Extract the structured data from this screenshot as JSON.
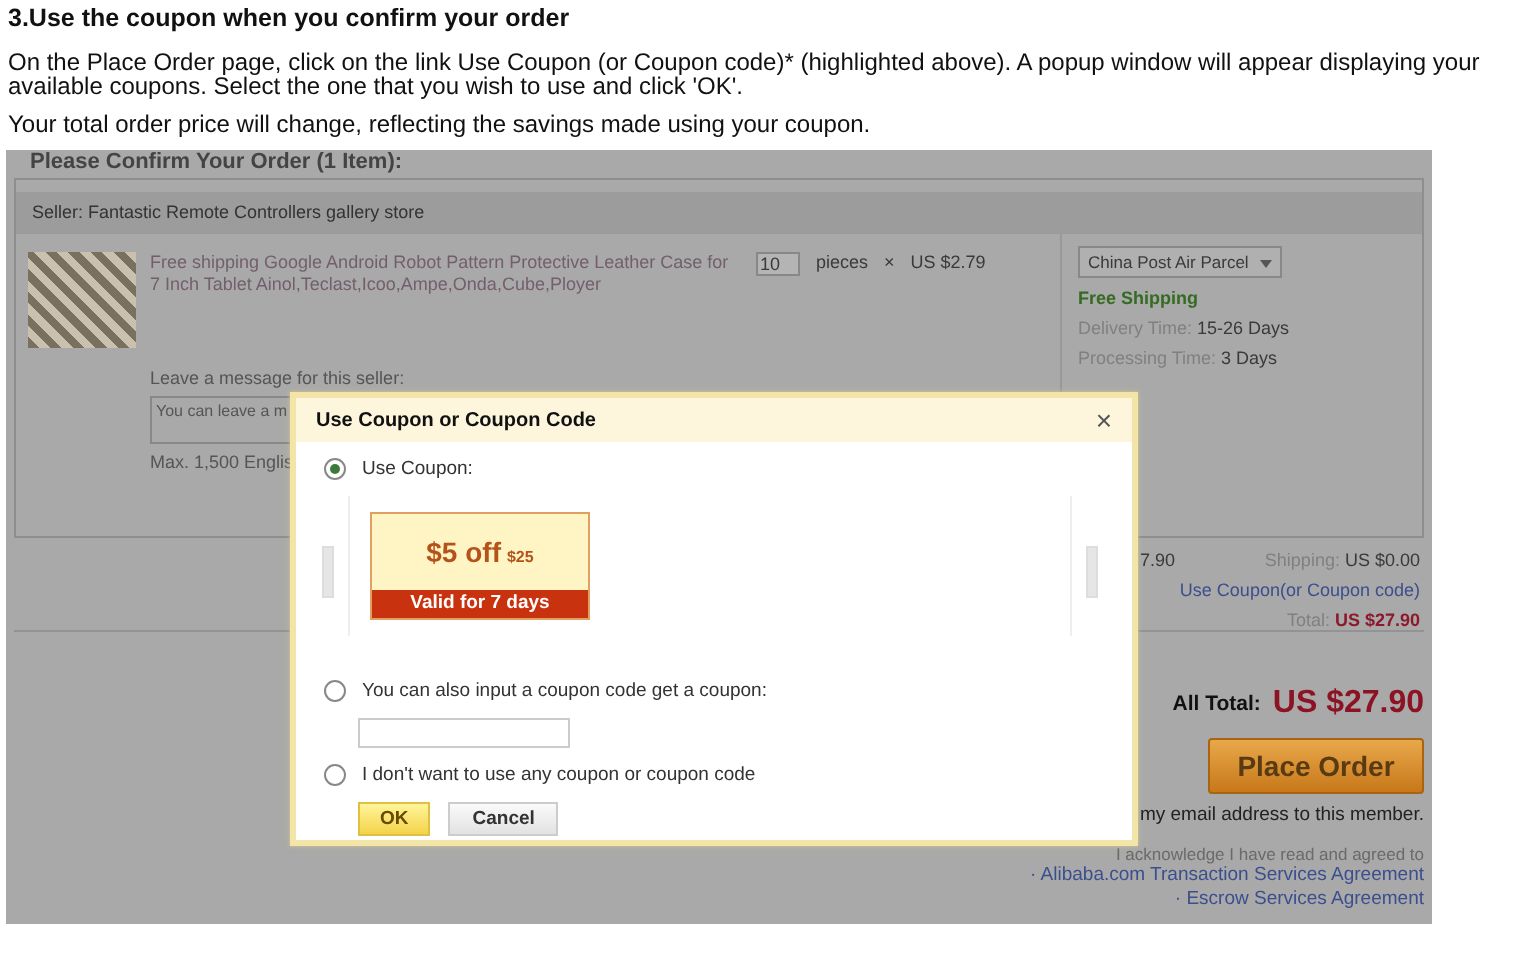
{
  "article": {
    "heading": "3.Use the coupon when you confirm your order",
    "paragraphs": [
      "On the Place Order page, click on the link Use Coupon (or Coupon code)* (highlighted above). A popup window will appear displaying your available coupons. Select the one that you wish to use and click 'OK'.",
      "Your total order price will change, reflecting the savings made using your coupon."
    ]
  },
  "order": {
    "heading": "Please Confirm Your Order (1 Item):",
    "seller": "Seller: Fantastic Remote Controllers gallery store",
    "product": {
      "title": "Free shipping Google Android Robot Pattern Protective Leather Case for 7 Inch Tablet Ainol,Teclast,Icoo,Ampe,Onda,Cube,Ployer",
      "quantity": "10",
      "unit": "pieces",
      "times": "×",
      "price": "US $2.79"
    },
    "shipping": {
      "method": "China Post Air Parcel",
      "free": "Free Shipping",
      "delivery_label": "Delivery Time:",
      "delivery_value": "15-26 Days",
      "processing_label": "Processing Time:",
      "processing_value": "3 Days"
    },
    "message": {
      "label": "Leave a message for this seller:",
      "placeholder": "You can leave a m",
      "limit": "Max. 1,500 Englis"
    },
    "summary": {
      "subtotal": "7.90",
      "shipping_label": "Shipping:",
      "shipping_value": "US $0.00",
      "coupon_link": "Use Coupon(or Coupon code)",
      "total_label": "Total:",
      "total_value": "US $27.90"
    },
    "all_total_label": "All Total:",
    "all_total_value": "US $27.90",
    "place_order": "Place Order",
    "email_note": "my email address to this member.",
    "agreement_note": "I acknowledge I have read and agreed to",
    "agreements": [
      "· Alibaba.com Transaction Services Agreement",
      "· Escrow Services Agreement"
    ]
  },
  "popup": {
    "title": "Use Coupon or Coupon Code",
    "close": "×",
    "options": [
      {
        "kind": "coupon",
        "label": "Use Coupon:",
        "selected": true,
        "coupon": {
          "amount": "$5 off",
          "minimum": "$25",
          "validity": "Valid for 7 days"
        }
      },
      {
        "kind": "code",
        "label": "You can also input a coupon code get a coupon:",
        "selected": false
      },
      {
        "kind": "none",
        "label": "I don't want to use any coupon or coupon code",
        "selected": false
      }
    ],
    "buttons": [
      {
        "label": "OK",
        "kind": "primary"
      },
      {
        "label": "Cancel",
        "kind": "secondary"
      }
    ]
  }
}
